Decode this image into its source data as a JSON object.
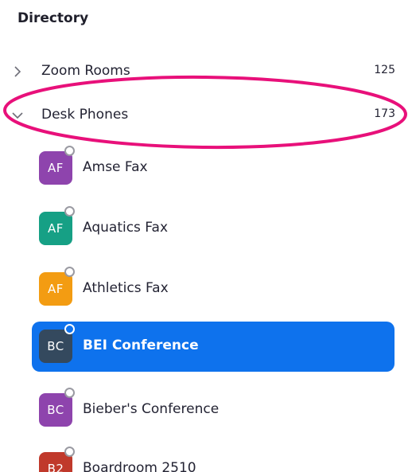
{
  "directory": {
    "title": "Directory",
    "groups": [
      {
        "label": "Zoom Rooms",
        "count": "125",
        "expanded": false,
        "chevron_icon": "chevron-right-icon"
      },
      {
        "label": "Desk Phones",
        "count": "173",
        "expanded": true,
        "chevron_icon": "chevron-down-icon"
      }
    ],
    "contacts": [
      {
        "initials": "AF",
        "name": "Amse Fax",
        "avatar_color": "#8e44ad",
        "selected": false
      },
      {
        "initials": "AF",
        "name": "Aquatics Fax",
        "avatar_color": "#16a085",
        "selected": false
      },
      {
        "initials": "AF",
        "name": "Athletics Fax",
        "avatar_color": "#f39c12",
        "selected": false
      },
      {
        "initials": "BC",
        "name": "BEI Conference",
        "avatar_color": "#34495e",
        "selected": true
      },
      {
        "initials": "BC",
        "name": "Bieber's Conference",
        "avatar_color": "#8e44ad",
        "selected": false
      },
      {
        "initials": "B2",
        "name": "Boardroom 2510",
        "avatar_color": "#c0392b",
        "selected": false
      }
    ]
  },
  "colors": {
    "selection": "#0e72ed",
    "annotation_ellipse": "#e8107a",
    "text": "#232333"
  }
}
